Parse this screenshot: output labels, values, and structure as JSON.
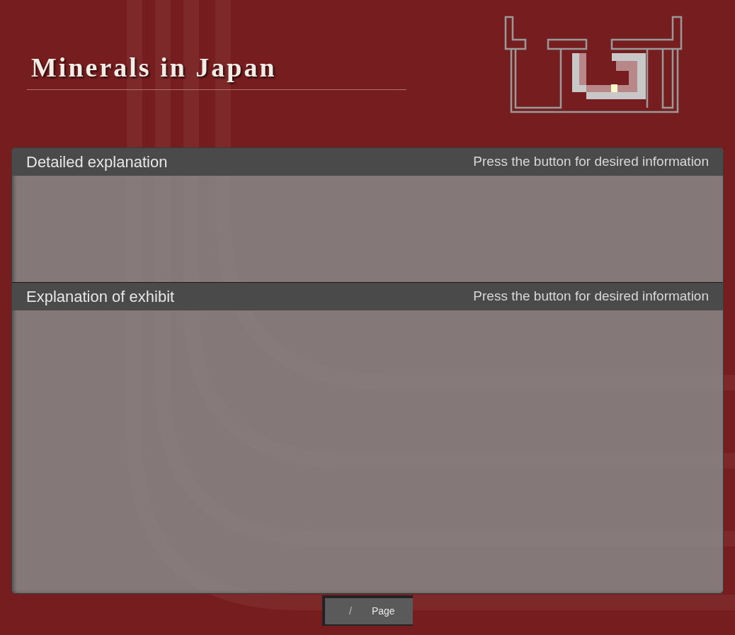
{
  "header": {
    "title": "Minerals in Japan"
  },
  "sections": [
    {
      "title": "Detailed explanation",
      "hint": "Press the button for desired information"
    },
    {
      "title": "Explanation of exhibit",
      "hint": "Press the button for desired information"
    }
  ],
  "pager": {
    "separator": "/",
    "label": "Page"
  }
}
